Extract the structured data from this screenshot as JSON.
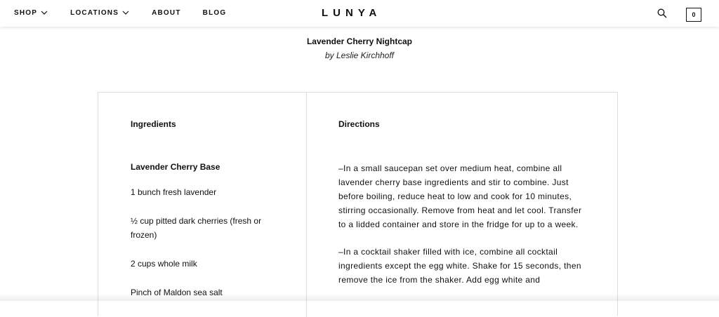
{
  "header": {
    "nav": [
      {
        "label": "SHOP",
        "dropdown": true
      },
      {
        "label": "LOCATIONS",
        "dropdown": true
      },
      {
        "label": "ABOUT",
        "dropdown": false
      },
      {
        "label": "BLOG",
        "dropdown": false
      }
    ],
    "logo": "LUNYA",
    "search_icon": "search-icon",
    "cart_count": "0"
  },
  "recipe": {
    "title": "Lavender Cherry Nightcap",
    "byline": "by Leslie Kirchhoff"
  },
  "ingredients": {
    "heading": "Ingredients",
    "base_heading": "Lavender Cherry Base",
    "items": [
      "1 bunch fresh lavender",
      "½ cup pitted dark cherries (fresh or frozen)",
      "2 cups whole milk",
      "Pinch of Maldon sea salt"
    ]
  },
  "directions": {
    "heading": "Directions",
    "steps": [
      "–In a small saucepan set over medium heat, combine all lavender cherry base ingredients and stir to combine. Just before boiling, reduce heat to low and cook for 10 minutes, stirring occasionally. Remove from heat and let cool. Transfer to a lidded container and store in the fridge for up to a week.",
      "–In a cocktail shaker filled with ice, combine all cocktail ingredients except the egg white. Shake for 15 seconds, then remove the ice from the shaker. Add egg white and"
    ]
  }
}
